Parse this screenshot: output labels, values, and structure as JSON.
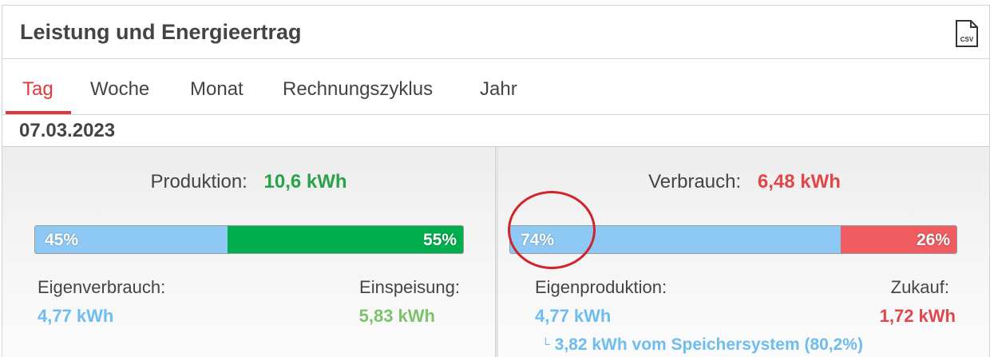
{
  "card": {
    "title": "Leistung und Energieertrag",
    "csv_label": "CSV",
    "csv_icon": "csv-file-icon"
  },
  "tabs": [
    {
      "label": "Tag",
      "active": true
    },
    {
      "label": "Woche",
      "active": false
    },
    {
      "label": "Monat",
      "active": false
    },
    {
      "label": "Rechnungszyklus",
      "active": false
    },
    {
      "label": "Jahr",
      "active": false
    }
  ],
  "date": "07.03.2023",
  "production": {
    "label": "Produktion:",
    "value": "10,6 kWh",
    "bar": {
      "self_pct_label": "45%",
      "feed_pct_label": "55%",
      "self_fraction": 0.45
    },
    "left_label": "Eigenverbrauch:",
    "left_value": "4,77 kWh",
    "right_label": "Einspeisung:",
    "right_value": "5,83 kWh"
  },
  "consumption": {
    "label": "Verbrauch:",
    "value": "6,48 kWh",
    "bar": {
      "self_pct_label": "74%",
      "purchase_pct_label": "26%",
      "self_fraction": 0.74
    },
    "left_label": "Eigenproduktion:",
    "left_value": "4,77 kWh",
    "right_label": "Zukauf:",
    "right_value": "1,72 kWh",
    "storage_note": "3,82 kWh vom Speichersystem (80,2%)"
  },
  "colors": {
    "accent_red": "#e0383b",
    "self_blue": "#8ec9f5",
    "feed_green": "#00ae4d",
    "purchase_red": "#f05c5f",
    "annotation_ring": "#d0242b"
  }
}
